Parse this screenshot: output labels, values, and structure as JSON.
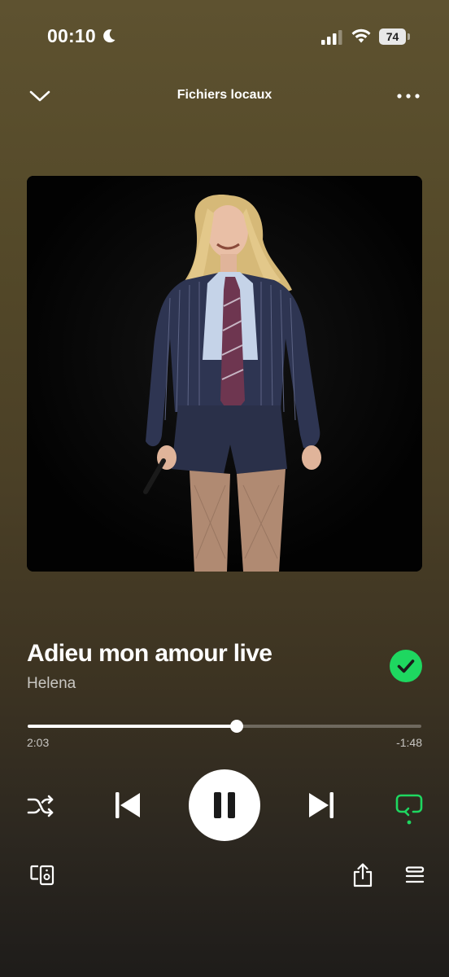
{
  "status_bar": {
    "time": "00:10",
    "battery_level": "74",
    "moon_icon": "moon-icon",
    "signal_icon": "cellular-signal-icon",
    "wifi_icon": "wifi-icon"
  },
  "header": {
    "title": "Fichiers locaux",
    "collapse_icon": "chevron-down-icon",
    "menu_icon": "more-options-icon"
  },
  "artwork": {
    "subject": "performer-on-stage"
  },
  "track": {
    "title": "Adieu mon amour live",
    "artist": "Helena",
    "liked": true
  },
  "playback": {
    "elapsed": "2:03",
    "remaining": "-1:48",
    "progress_fraction": 0.532,
    "state": "playing"
  },
  "controls": {
    "shuffle_icon": "shuffle-icon",
    "previous_icon": "skip-previous-icon",
    "play_pause_icon": "pause-icon",
    "next_icon": "skip-next-icon",
    "repeat_icon": "repeat-icon",
    "repeat_active": true
  },
  "footer": {
    "devices_icon": "connect-devices-icon",
    "share_icon": "share-icon",
    "queue_icon": "queue-icon"
  },
  "colors": {
    "accent_green": "#1ed760",
    "background_top": "#5e5230",
    "background_bottom": "#1e1c1a",
    "text_primary": "#ffffff",
    "text_secondary": "#bdb7a8"
  }
}
